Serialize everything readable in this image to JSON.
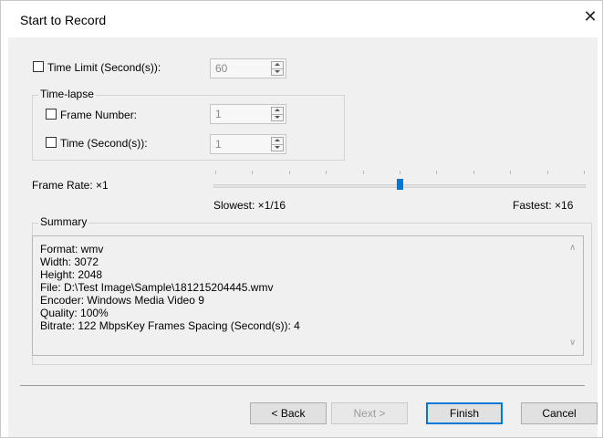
{
  "window": {
    "title": "Start to Record",
    "close_glyph": "✕"
  },
  "time_limit": {
    "label": "Time Limit (Second(s)):",
    "checked": false,
    "value": "60"
  },
  "time_lapse": {
    "group_label": "Time-lapse",
    "frame_number": {
      "label": "Frame Number:",
      "checked": false,
      "value": "1"
    },
    "time": {
      "label": "Time (Second(s)):",
      "checked": false,
      "value": "1"
    }
  },
  "frame_rate": {
    "label": "Frame Rate: ×1",
    "slowest_label": "Slowest: ×1/16",
    "fastest_label": "Fastest: ×16",
    "position_fraction": 0.5,
    "tick_count": 11,
    "thumb_color": "#0078d7"
  },
  "summary": {
    "group_label": "Summary",
    "lines": [
      "Format: wmv",
      "Width: 3072",
      "Height: 2048",
      "File: D:\\Test Image\\Sample\\181215204445.wmv",
      "Encoder: Windows Media Video 9",
      "Quality: 100%",
      "Bitrate: 122 MbpsKey Frames Spacing (Second(s)): 4"
    ],
    "scroll_up_glyph": "∧",
    "scroll_down_glyph": "∨"
  },
  "buttons": {
    "back": "< Back",
    "next": "Next >",
    "finish": "Finish",
    "cancel": "Cancel"
  }
}
